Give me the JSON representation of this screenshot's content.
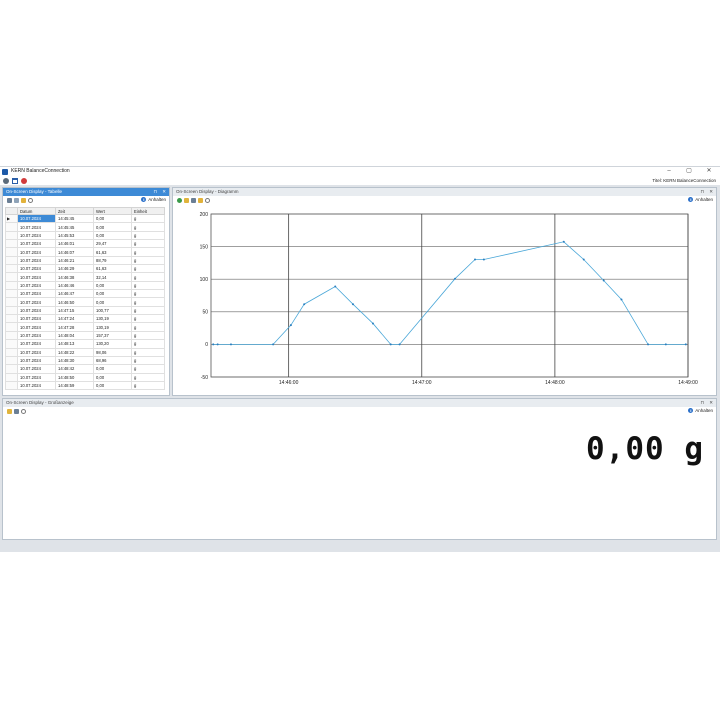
{
  "window": {
    "title": "KERN BalanceConnection",
    "controls": {
      "minimize": "–",
      "maximize": "▢",
      "close": "✕"
    }
  },
  "toolbar": {
    "icons": [
      "settings-icon",
      "window-icon",
      "stop-icon"
    ],
    "titel_label": "Titel:",
    "titel_value": "KERN BalanceConnection"
  },
  "table_panel": {
    "title": "On-Screen Display - Tabelle",
    "header_controls": [
      "⊓",
      "✕"
    ],
    "tools": [
      "save-icon",
      "copy-icon",
      "edit-icon",
      "zoom-icon"
    ],
    "anhalten": "Anhalten",
    "columns": [
      "Datum",
      "Zeit",
      "Wert",
      "Einheit"
    ],
    "rows": [
      {
        "datum": "10.07.2024",
        "zeit": "14:45:45",
        "wert": "0,00",
        "einheit": "g"
      },
      {
        "datum": "10.07.2024",
        "zeit": "14:45:45",
        "wert": "0,00",
        "einheit": "g"
      },
      {
        "datum": "10.07.2024",
        "zeit": "14:45:53",
        "wert": "0,00",
        "einheit": "g"
      },
      {
        "datum": "10.07.2024",
        "zeit": "14:46:01",
        "wert": "29,47",
        "einheit": "g"
      },
      {
        "datum": "10.07.2024",
        "zeit": "14:46:07",
        "wert": "61,63",
        "einheit": "g"
      },
      {
        "datum": "10.07.2024",
        "zeit": "14:46:21",
        "wert": "88,79",
        "einheit": "g"
      },
      {
        "datum": "10.07.2024",
        "zeit": "14:46:29",
        "wert": "61,63",
        "einheit": "g"
      },
      {
        "datum": "10.07.2024",
        "zeit": "14:46:38",
        "wert": "32,14",
        "einheit": "g"
      },
      {
        "datum": "10.07.2024",
        "zeit": "14:46:46",
        "wert": "0,00",
        "einheit": "g"
      },
      {
        "datum": "10.07.2024",
        "zeit": "14:46:47",
        "wert": "0,00",
        "einheit": "g"
      },
      {
        "datum": "10.07.2024",
        "zeit": "14:46:50",
        "wert": "0,00",
        "einheit": "g"
      },
      {
        "datum": "10.07.2024",
        "zeit": "14:47:15",
        "wert": "100,77",
        "einheit": "g"
      },
      {
        "datum": "10.07.2024",
        "zeit": "14:47:24",
        "wert": "130,19",
        "einheit": "g"
      },
      {
        "datum": "10.07.2024",
        "zeit": "14:47:28",
        "wert": "130,19",
        "einheit": "g"
      },
      {
        "datum": "10.07.2024",
        "zeit": "14:48:04",
        "wert": "157,37",
        "einheit": "g"
      },
      {
        "datum": "10.07.2024",
        "zeit": "14:48:13",
        "wert": "130,20",
        "einheit": "g"
      },
      {
        "datum": "10.07.2024",
        "zeit": "14:48:22",
        "wert": "98,06",
        "einheit": "g"
      },
      {
        "datum": "10.07.2024",
        "zeit": "14:48:30",
        "wert": "68,96",
        "einheit": "g"
      },
      {
        "datum": "10.07.2024",
        "zeit": "14:48:42",
        "wert": "0,00",
        "einheit": "g"
      },
      {
        "datum": "10.07.2024",
        "zeit": "14:48:50",
        "wert": "0,00",
        "einheit": "g"
      },
      {
        "datum": "10.07.2024",
        "zeit": "14:48:59",
        "wert": "0,00",
        "einheit": "g"
      }
    ]
  },
  "chart_panel": {
    "title": "On-Screen Display - Diagramm",
    "header_controls": [
      "⊓",
      "✕"
    ],
    "tools": [
      "chart-play-icon",
      "chart-print-icon",
      "chart-save-icon",
      "chart-edit-icon",
      "chart-zoom-icon"
    ],
    "anhalten": "Anhalten"
  },
  "display_panel": {
    "title": "On-Screen Display - Großanzeige",
    "header_controls": [
      "⊓",
      "✕"
    ],
    "tools": [
      "display-folder-icon",
      "display-save-icon",
      "display-zoom-icon"
    ],
    "anhalten": "Anhalten",
    "value": "0,00 g"
  },
  "chart_data": {
    "type": "line",
    "title": "",
    "xlabel": "",
    "ylabel": "",
    "x_ticks": [
      "14:46:00",
      "14:47:00",
      "14:48:00",
      "14:49:00"
    ],
    "y_ticks": [
      "200",
      "150",
      "100",
      "50",
      "0",
      "-50"
    ],
    "ylim": [
      -50,
      200
    ],
    "xlim": [
      "14:45:25",
      "14:49:00"
    ],
    "grid": true,
    "color": "#4aa7d8",
    "series": [
      {
        "x": [
          "14:45:26",
          "14:45:28",
          "14:45:34",
          "14:45:53",
          "14:46:01",
          "14:46:07",
          "14:46:21",
          "14:46:29",
          "14:46:38",
          "14:46:46",
          "14:46:50",
          "14:47:15",
          "14:47:24",
          "14:47:28",
          "14:48:04",
          "14:48:13",
          "14:48:22",
          "14:48:30",
          "14:48:42",
          "14:48:50",
          "14:48:59"
        ],
        "y": [
          0,
          0,
          0,
          0,
          29.47,
          61.63,
          88.79,
          61.63,
          32.14,
          0,
          0,
          100.77,
          130.19,
          130.19,
          157.37,
          130.2,
          98.06,
          68.96,
          0,
          0,
          0
        ]
      }
    ]
  }
}
